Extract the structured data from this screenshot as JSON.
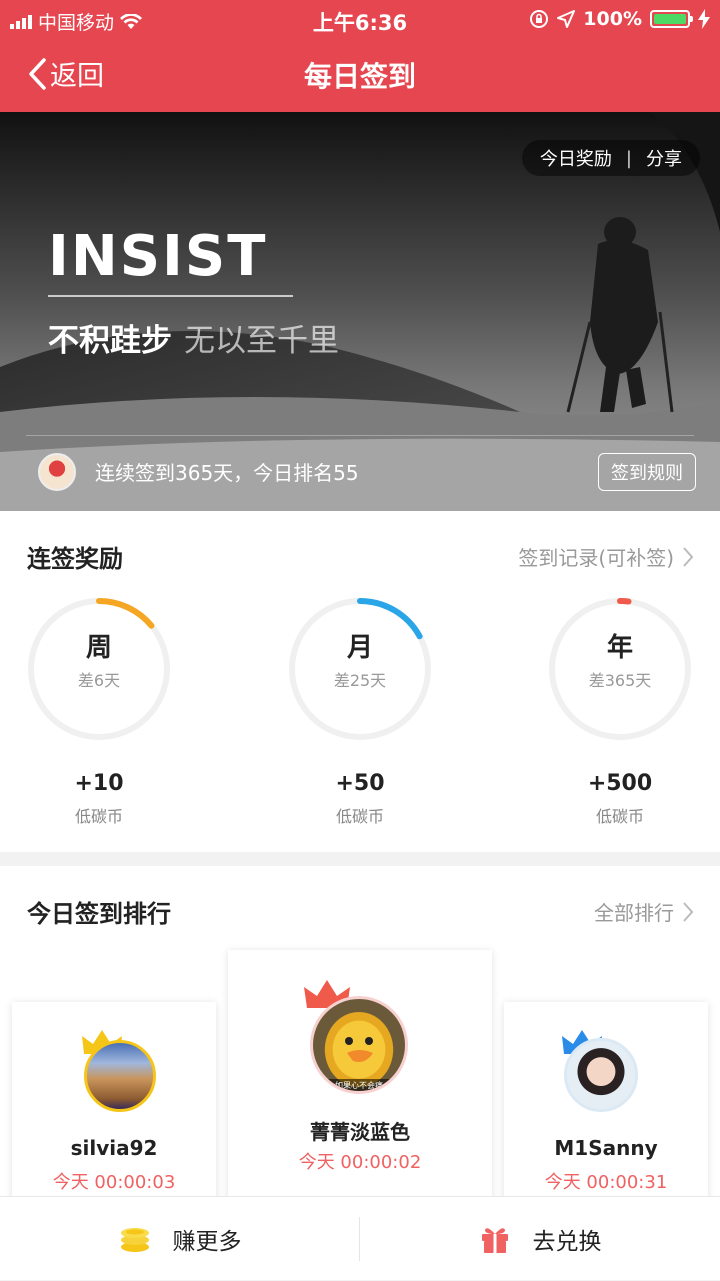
{
  "status_bar": {
    "carrier": "中国移动",
    "time": "上午6:36",
    "battery": "100%"
  },
  "nav": {
    "back_label": "返回",
    "title": "每日签到"
  },
  "banner": {
    "today_reward": "今日奖励",
    "divider": "|",
    "share": "分享",
    "headline": "INSIST",
    "motto_a": "不积跬步",
    "motto_b": "无以至千里",
    "streak_text": "连续签到365天，今日排名55",
    "rules_button": "签到规则"
  },
  "rewards_section": {
    "title": "连签奖励",
    "link": "签到记录(可补签)",
    "rings": [
      {
        "period": "周",
        "diff": "差6天",
        "reward": "+10",
        "unit": "低碳币",
        "color": "#f5a623",
        "progress": 0.14
      },
      {
        "period": "月",
        "diff": "差25天",
        "reward": "+50",
        "unit": "低碳币",
        "color": "#2aa6e8",
        "progress": 0.17
      },
      {
        "period": "年",
        "diff": "差365天",
        "reward": "+500",
        "unit": "低碳币",
        "color": "#f05a4a",
        "progress": 0.02
      }
    ]
  },
  "ranking_section": {
    "title": "今日签到排行",
    "link": "全部排行",
    "entries": [
      {
        "name": "silvia92",
        "time": "今天 00:00:03",
        "crown_color": "#f5c518"
      },
      {
        "name": "菁菁淡蓝色",
        "time": "今天 00:00:02",
        "crown_color": "#f05a4a"
      },
      {
        "name": "M1Sanny",
        "time": "今天 00:00:31",
        "crown_color": "#2a8be8"
      }
    ],
    "avatar_caption": "如果心不会痛"
  },
  "bottom_bar": {
    "earn_more": "赚更多",
    "redeem": "去兑换"
  },
  "colors": {
    "brand": "#e6464f",
    "accent_red": "#f06262"
  }
}
